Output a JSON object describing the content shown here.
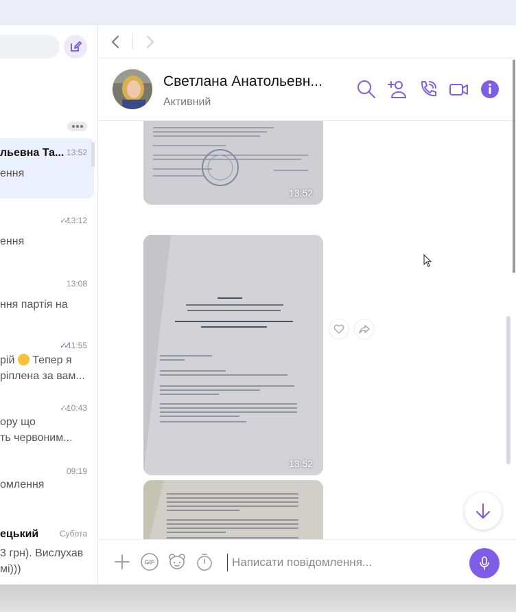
{
  "sidebar": {
    "chats": [
      {
        "name": "льевна Та...",
        "time": "13:52",
        "message": "ення",
        "status": ""
      },
      {
        "name": "",
        "time": "13:12",
        "message": "ення",
        "status": "read-gray"
      },
      {
        "name": "",
        "time": "13:08",
        "message": "ння партія на",
        "status": ""
      },
      {
        "name": "",
        "time": "11:55",
        "message_line1": "рій",
        "message_line1b": "Тепер я",
        "message_line2": "ріплена за вам...",
        "status": "read"
      },
      {
        "name": "",
        "time": "10:43",
        "message_line1": "ору що",
        "message_line2": "ть червоним...",
        "status": "read-gray"
      },
      {
        "name": "",
        "time": "09:19",
        "message": "омлення",
        "status": ""
      },
      {
        "name": "ецький",
        "time": "Субота",
        "message_line1": "3 грн). Вислухав",
        "message_line2": "мі)))",
        "status": ""
      }
    ]
  },
  "header": {
    "contact_name": "Светлана Анатольевн...",
    "contact_status": "Активний"
  },
  "messages": [
    {
      "type": "photo",
      "time": "13:52"
    },
    {
      "type": "photo",
      "time": "13:52"
    },
    {
      "type": "photo",
      "time": ""
    }
  ],
  "composer": {
    "placeholder": "Написати повідомлення..."
  },
  "colors": {
    "accent": "#7f5de4",
    "active_chat_bg": "#eaf0fd"
  },
  "icons": [
    "compose-icon",
    "back-arrow-icon",
    "forward-arrow-icon",
    "search-icon",
    "add-contact-icon",
    "phone-icon",
    "video-icon",
    "info-icon",
    "heart-icon",
    "share-icon",
    "scroll-down-icon",
    "plus-icon",
    "gif-icon",
    "sticker-icon",
    "timer-icon",
    "mic-icon"
  ]
}
